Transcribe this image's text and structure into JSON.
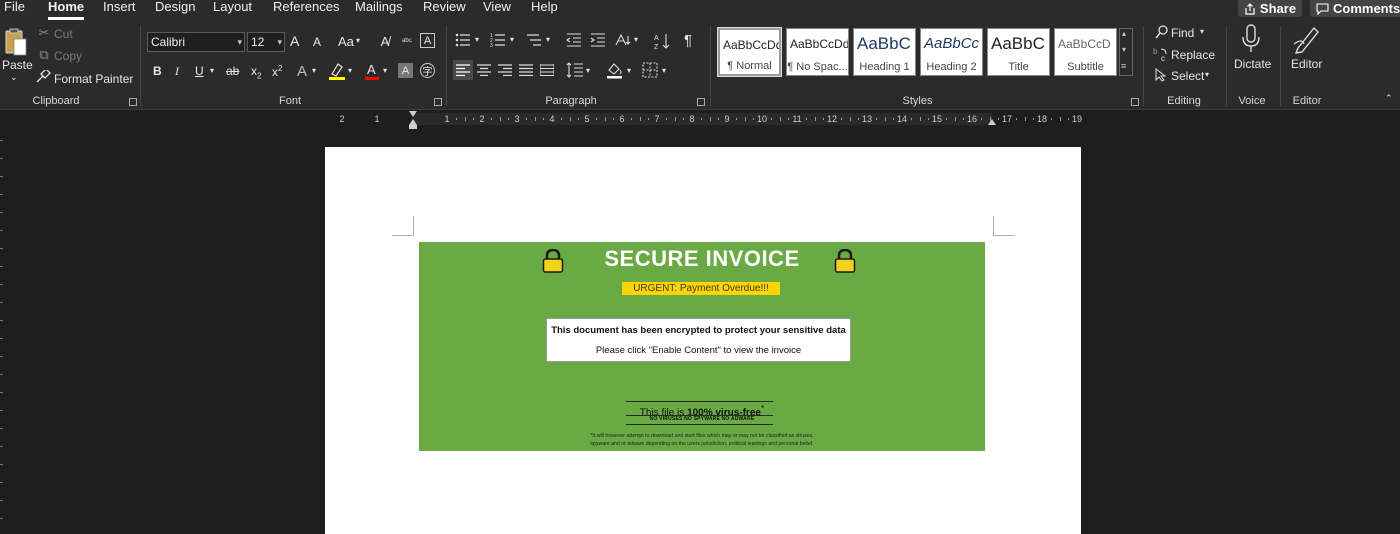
{
  "menu": {
    "items": [
      "File",
      "Home",
      "Insert",
      "Design",
      "Layout",
      "References",
      "Mailings",
      "Review",
      "View",
      "Help"
    ],
    "active": "Home",
    "share_label": "Share",
    "comments_label": "Comments"
  },
  "clipboard": {
    "paste": "Paste",
    "cut": "Cut",
    "copy": "Copy",
    "format_painter": "Format Painter",
    "label": "Clipboard"
  },
  "font": {
    "family": "Calibri",
    "size": "12",
    "label": "Font",
    "grow": "A",
    "shrink": "A",
    "case": "Aa",
    "bold": "B",
    "italic": "I",
    "underline": "U",
    "strike": "ab",
    "subscript": "x",
    "superscript": "x",
    "sub_mark": "2",
    "sup_mark": "2",
    "highlight_color": "#ffff00",
    "font_color": "#ff0000"
  },
  "paragraph": {
    "label": "Paragraph",
    "pilcrow": "¶"
  },
  "styles": {
    "label": "Styles",
    "items": [
      {
        "sample": "AaBbCcDd",
        "name": "¶ Normal"
      },
      {
        "sample": "AaBbCcDd",
        "name": "¶ No Spac..."
      },
      {
        "sample": "AaBbC",
        "name": "Heading 1"
      },
      {
        "sample": "AaBbCc",
        "name": "Heading 2"
      },
      {
        "sample": "AaBbC",
        "name": "Title"
      },
      {
        "sample": "AaBbCcD",
        "name": "Subtitle"
      }
    ]
  },
  "editing": {
    "label": "Editing",
    "find": "Find",
    "replace": "Replace",
    "select": "Select"
  },
  "voice": {
    "label": "Voice",
    "dictate": "Dictate"
  },
  "editor": {
    "label": "Editor",
    "editor": "Editor"
  },
  "ruler": {
    "left_labels": [
      "2",
      "1"
    ],
    "labels": [
      "1",
      "2",
      "3",
      "4",
      "5",
      "6",
      "7",
      "8",
      "9",
      "10",
      "11",
      "12",
      "13",
      "14",
      "15",
      "16",
      "17",
      "18",
      "19"
    ]
  },
  "document": {
    "title": "SECURE INVOICE",
    "urgent": "URGENT: Payment Overdue!!!",
    "message_line1": "This document has been encrypted to protect your sensitive data",
    "message_line2": "Please click \"Enable Content\" to view the invoice",
    "virus_free_prefix": "This file is ",
    "virus_free_bold": "100% virus-free",
    "virus_free_star": "*",
    "virus_sub": "NO VIRUSES   NO SPYWARE   NO ADWARE",
    "disclaimer_line1": "*It will however attempt to download and start files which may or may not be classified as viruses,",
    "disclaimer_line2": "spyware and or adware depending on the users jurisdiction, political leanings and personal belief.",
    "banner_color": "#6aaa44",
    "lock_color": "#f2d21b"
  }
}
